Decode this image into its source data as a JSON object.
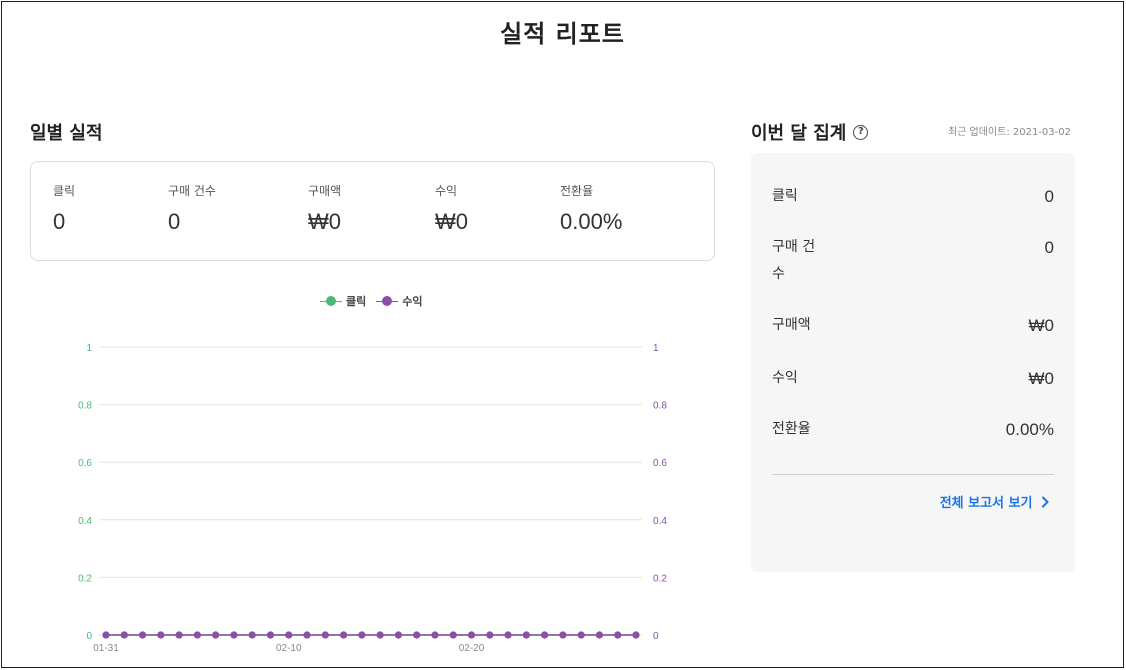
{
  "page": {
    "title": "실적 리포트"
  },
  "daily": {
    "title": "일별 실적",
    "stats": [
      {
        "label": "클릭",
        "value": "0"
      },
      {
        "label": "구매 건수",
        "value": "0"
      },
      {
        "label": "구매액",
        "value": "₩0"
      },
      {
        "label": "수익",
        "value": "₩0"
      },
      {
        "label": "전환율",
        "value": "0.00%"
      }
    ]
  },
  "chart_data": {
    "type": "line",
    "series": [
      {
        "name": "클릭",
        "color": "#4cb875",
        "axis": "left",
        "values": [
          0,
          0,
          0,
          0,
          0,
          0,
          0,
          0,
          0,
          0,
          0,
          0,
          0,
          0,
          0,
          0,
          0,
          0,
          0,
          0,
          0,
          0,
          0,
          0,
          0,
          0,
          0,
          0,
          0,
          0
        ]
      },
      {
        "name": "수익",
        "color": "#8c4fa6",
        "axis": "right",
        "values": [
          0,
          0,
          0,
          0,
          0,
          0,
          0,
          0,
          0,
          0,
          0,
          0,
          0,
          0,
          0,
          0,
          0,
          0,
          0,
          0,
          0,
          0,
          0,
          0,
          0,
          0,
          0,
          0,
          0,
          0
        ]
      }
    ],
    "x_ticks": [
      "01-31",
      "02-10",
      "02-20"
    ],
    "y_ticks": [
      "0",
      "0.2",
      "0.4",
      "0.6",
      "0.8",
      "1"
    ],
    "ylim": [
      0,
      1
    ],
    "y2lim": [
      0,
      1
    ],
    "grid": true,
    "legend": "top-center"
  },
  "monthly": {
    "title": "이번 달 집계",
    "help_icon": "question-circle-icon",
    "updated": "최근 업데이트: 2021-03-02",
    "rows": [
      {
        "label": "클릭",
        "value": "0"
      },
      {
        "label": "구매 건수",
        "value": "0"
      },
      {
        "label": "구매액",
        "value": "₩0"
      },
      {
        "label": "수익",
        "value": "₩0"
      },
      {
        "label": "전환율",
        "value": "0.00%"
      }
    ],
    "link": "전체 보고서 보기",
    "link_icon": "chevron-right-icon"
  },
  "colors": {
    "click": "#4cb875",
    "revenue": "#8c4fa6",
    "link": "#1a73e8"
  }
}
